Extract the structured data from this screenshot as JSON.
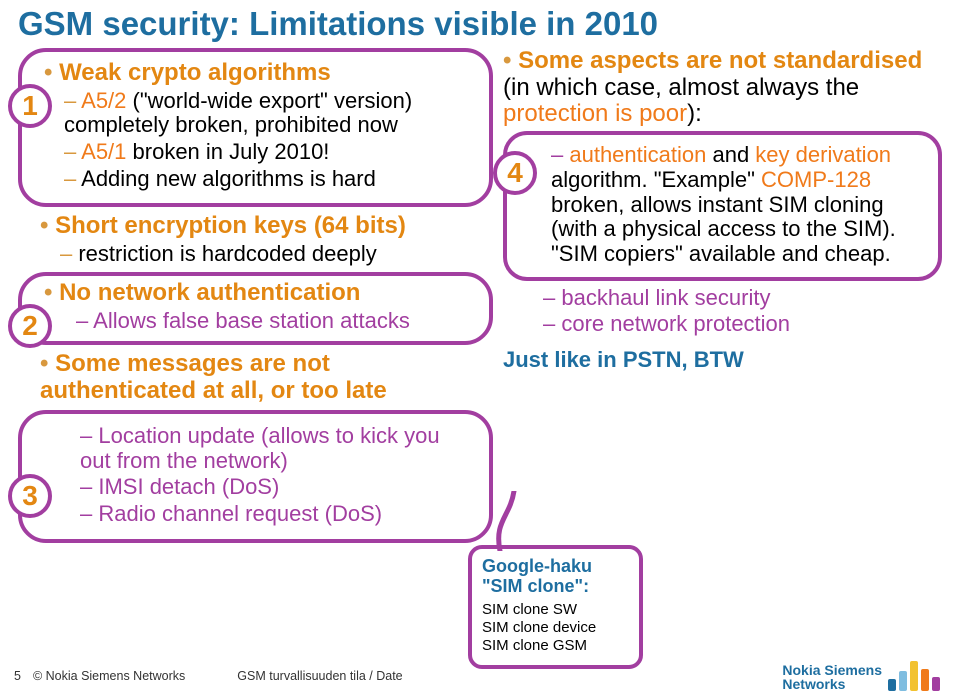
{
  "title": "GSM security: Limitations visible in 2010",
  "left": {
    "box1": {
      "badge": "1",
      "h": "Weak crypto algorithms",
      "s1a": "A5/2",
      "s1b": " (\"world-wide export\" version) completely broken, prohibited now",
      "s2a": "A5/1",
      "s2b": " broken in July 2010!",
      "s3": "Adding new algorithms is hard"
    },
    "plain1": {
      "h": "Short encryption keys (64 bits)",
      "s1": "restriction is hardcoded deeply"
    },
    "box2": {
      "badge": "2",
      "h": "No network authentication",
      "s1": "Allows false base station attacks"
    },
    "box3": {
      "badge": "3",
      "h": "Some messages are not authenticated at all, or too late",
      "s1": "Location update (allows to kick you out from the network)",
      "s2": "IMSI detach (DoS)",
      "s3": "Radio channel request (DoS)"
    }
  },
  "right": {
    "lead": "Some aspects are not standardised",
    "cont_a": " (in which case, almost always the ",
    "cont_b": "protection is poor",
    "cont_c": "):",
    "box4": {
      "badge": "4",
      "line1_a": "authentication",
      "line1_b": " and ",
      "line1_c": "key derivation",
      "line1_d": " algorithm. \"Example\" ",
      "line1_e": "COMP-128",
      "line1_f": " broken, allows instant SIM cloning (with a physical access to the SIM). \"SIM copiers\" available and cheap."
    },
    "tail1": "backhaul link security",
    "tail2": "core network protection",
    "justlike": "Just like in PSTN, BTW"
  },
  "callout": {
    "cap1": "Google-haku",
    "cap2": "\"SIM clone\":",
    "i1": "SIM clone SW",
    "i2": "SIM clone device",
    "i3": "SIM clone GSM"
  },
  "footer": {
    "page": "5",
    "copy": "© Nokia Siemens Networks",
    "right": "GSM turvallisuuden tila / Date",
    "logo1": "Nokia Siemens",
    "logo2": "Networks"
  }
}
